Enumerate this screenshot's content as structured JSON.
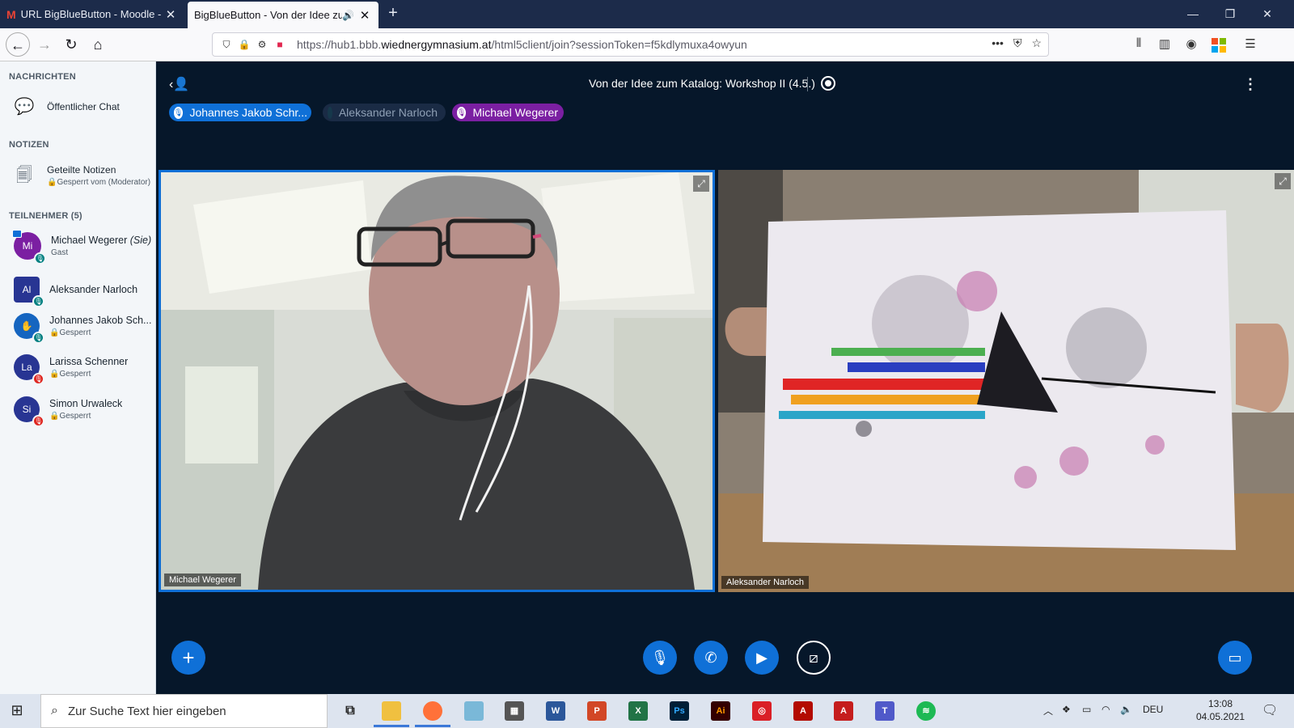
{
  "browser": {
    "tabs": [
      {
        "title": "URL BigBlueButton - Moodle -",
        "icon": "gmail-icon",
        "active": false
      },
      {
        "title": "BigBlueButton - Von der Idee zu",
        "icon": "speaker-icon",
        "active": true
      }
    ],
    "url_prefix": "https://hub1.bbb.",
    "url_domain": "wiednergymnasium.at",
    "url_path": "/html5client/join?sessionToken=f5kdlymuxa4owyun"
  },
  "sidebar": {
    "messages_header": "NACHRICHTEN",
    "public_chat": "Öffentlicher Chat",
    "notes_header": "NOTIZEN",
    "shared_notes": "Geteilte Notizen",
    "shared_notes_status": "Gesperrt vom (Moderator)",
    "participants_header": "TEILNEHMER (5)",
    "participants": [
      {
        "initials": "Mi",
        "name": "Michael Wegerer",
        "suffix": "(Sie)",
        "role": "Gast",
        "color": "#7b1fa2",
        "shape": "circle",
        "status": "mic"
      },
      {
        "initials": "Al",
        "name": "Aleksander Narloch",
        "suffix": "",
        "role": "",
        "color": "#283593",
        "shape": "square",
        "status": "mic"
      },
      {
        "initials": "✋",
        "name": "Johannes Jakob Sch...",
        "suffix": "",
        "role": "Gesperrt",
        "color": "#1565c0",
        "shape": "circle",
        "status": "mic"
      },
      {
        "initials": "La",
        "name": "Larissa Schenner",
        "suffix": "",
        "role": "Gesperrt",
        "color": "#283593",
        "shape": "circle",
        "status": "muted"
      },
      {
        "initials": "Si",
        "name": "Simon Urwaleck",
        "suffix": "",
        "role": "Gesperrt",
        "color": "#283593",
        "shape": "circle",
        "status": "muted"
      }
    ]
  },
  "meeting": {
    "title": "Von der Idee zum Katalog: Workshop II (4.5.)",
    "talkers": [
      {
        "name": "Johannes Jakob Schr...",
        "color": "#0f70d7",
        "text_color": "#ffffff"
      },
      {
        "name": "Aleksander Narloch",
        "color": "#1a2b45",
        "text_color": "#8fa0b5"
      },
      {
        "name": "Michael Wegerer",
        "color": "#7b1fa2",
        "text_color": "#ffffff"
      }
    ],
    "videos": [
      {
        "label": "Michael Wegerer"
      },
      {
        "label": "Aleksander Narloch"
      }
    ]
  },
  "taskbar": {
    "search_placeholder": "Zur Suche Text hier eingeben",
    "language": "DEU",
    "time": "13:08",
    "date": "04.05.2021"
  }
}
